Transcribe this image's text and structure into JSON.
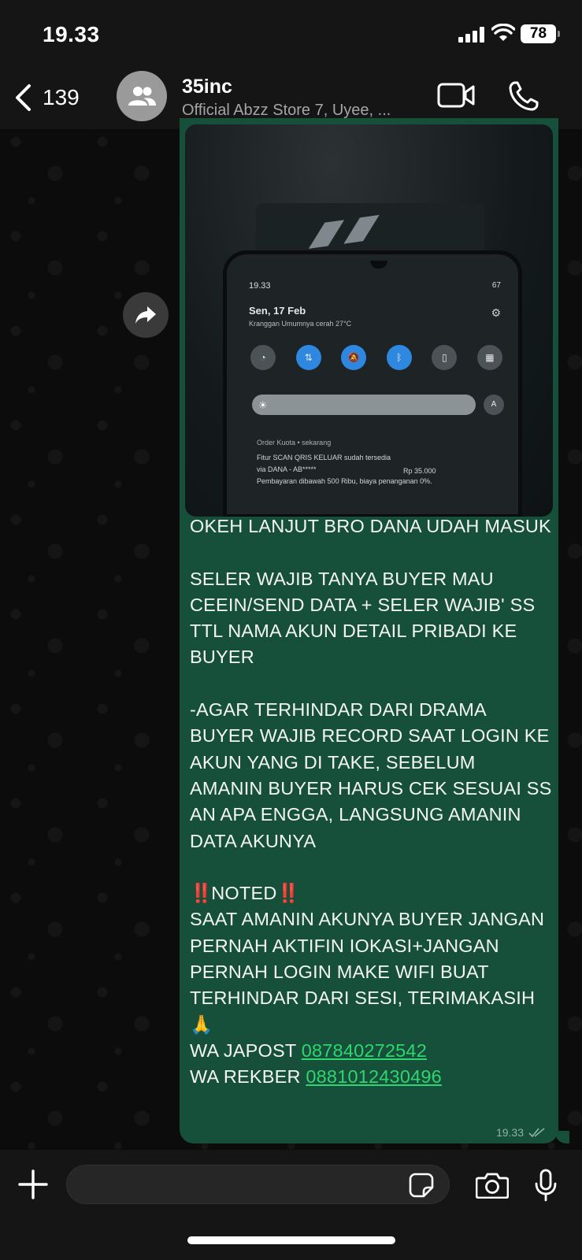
{
  "status_bar": {
    "time": "19.33",
    "battery": "78"
  },
  "header": {
    "back_count": "139",
    "title": "35inc",
    "subtitle": "Official Abzz Store 7, Uyee, ..."
  },
  "message": {
    "photo": {
      "time": "19.33",
      "battery": "67",
      "date": "Sen, 17 Feb",
      "weather": "Kranggan Umumnya cerah 27°C",
      "auto_label": "A",
      "notification_app": "Order Kuota • sekarang",
      "notification_line1": "Fitur SCAN QRIS KELUAR sudah tersedia",
      "notification_line2": "via DANA - AB*****",
      "notification_amount": "Rp 35.000",
      "notification_line3": "Pembayaran dibawah 500 Ribu, biaya penanganan 0%."
    },
    "paragraph1": "OKEH LANJUT BRO DANA UDAH MASUK",
    "paragraph2": "SELER WAJIB TANYA BUYER MAU CEEIN/SEND DATA + SELER WAJIB' SS TTL NAMA AKUN DETAIL PRIBADI KE BUYER",
    "paragraph3": "-AGAR TERHINDAR DARI DRAMA BUYER WAJIB RECORD SAAT LOGIN KE AKUN YANG DI TAKE, SEBELUM AMANIN BUYER HARUS CEK SESUAI SS AN APA ENGGA, LANGSUNG AMANIN DATA AKUNYA",
    "noted_marks": "‼️",
    "noted_label": "NOTED",
    "paragraph4": "SAAT AMANIN AKUNYA BUYER JANGAN PERNAH AKTIFIN IOKASI+JANGAN PERNAH LOGIN MAKE WIFI BUAT TERHINDAR DARI SESI, TERIMAKASIH 🙏",
    "japost_label": "WA JAPOST ",
    "japost_number": "087840272542",
    "rekber_label": "WA REKBER ",
    "rekber_number": "0881012430496",
    "timestamp": "19.33"
  },
  "input": {
    "placeholder": ""
  },
  "colors": {
    "bubble": "#17503a",
    "link": "#2fd56f",
    "background": "#0c0c0c",
    "bar": "#151515"
  },
  "icons": [
    "back-chevron-icon",
    "group-avatar-icon",
    "video-call-icon",
    "phone-call-icon",
    "forward-icon",
    "read-receipt-icon",
    "plus-icon",
    "sticker-icon",
    "camera-icon",
    "microphone-icon"
  ]
}
